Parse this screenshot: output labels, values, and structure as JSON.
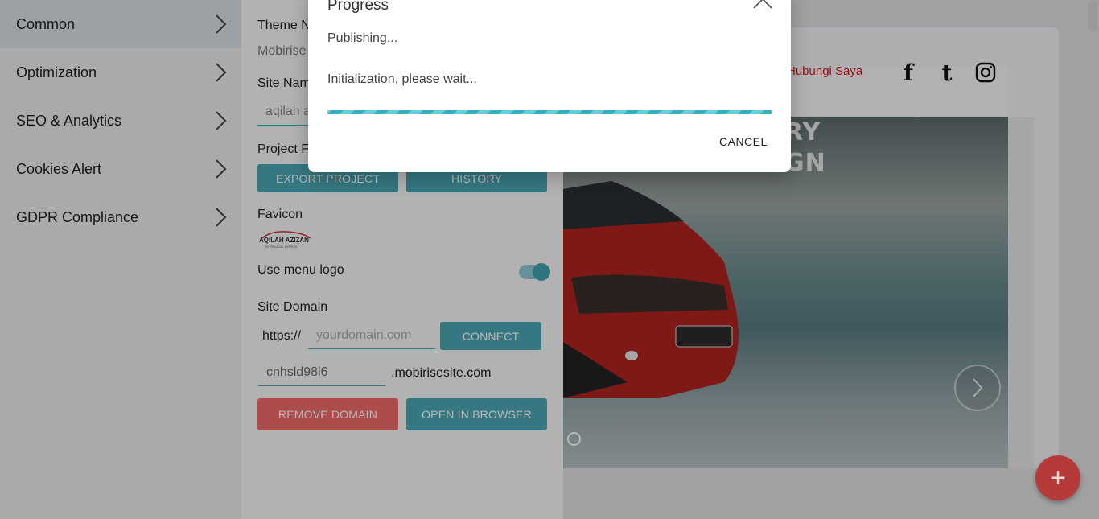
{
  "nav": {
    "items": [
      {
        "label": "Common",
        "active": true
      },
      {
        "label": "Optimization"
      },
      {
        "label": "SEO & Analytics"
      },
      {
        "label": "Cookies Alert"
      },
      {
        "label": "GDPR Compliance"
      }
    ]
  },
  "panel": {
    "theme_label": "Theme N",
    "theme_value": "Mobirise",
    "site_name_label": "Site Nam",
    "site_name_value": "aqilah a",
    "project_files_label": "Project Fi",
    "export_button": "EXPORT PROJECT",
    "history_button": "HISTORY",
    "favicon_label": "Favicon",
    "favicon_text": "AQILAH AZIZAN",
    "favicon_subtext": "SI PENJUAL KERETA",
    "use_menu_logo_label": "Use menu logo",
    "use_menu_logo_on": true,
    "site_domain_label": "Site Domain",
    "domain_prefix": "https://",
    "domain_placeholder": "yourdomain.com",
    "connect_button": "CONNECT",
    "subdomain_value": "cnhsld98l6",
    "subdomain_suffix": ".mobirisesite.com",
    "remove_domain_button": "REMOVE DOMAIN",
    "open_browser_button": "OPEN IN BROWSER"
  },
  "preview": {
    "nav_link": "Hubungi Saya",
    "hero_line1": "RY",
    "hero_line2": "GN",
    "social_icons": [
      "facebook-icon",
      "tumblr-icon",
      "instagram-icon"
    ]
  },
  "modal": {
    "title": "Progress",
    "status": "Publishing...",
    "message": "Initialization, please wait...",
    "progress": 1.0,
    "cancel_button": "CANCEL"
  },
  "colors": {
    "accent": "#4aa7b3",
    "danger": "#ef6a6a",
    "fab": "#b63a3a",
    "progress": "#3aa9c2"
  }
}
